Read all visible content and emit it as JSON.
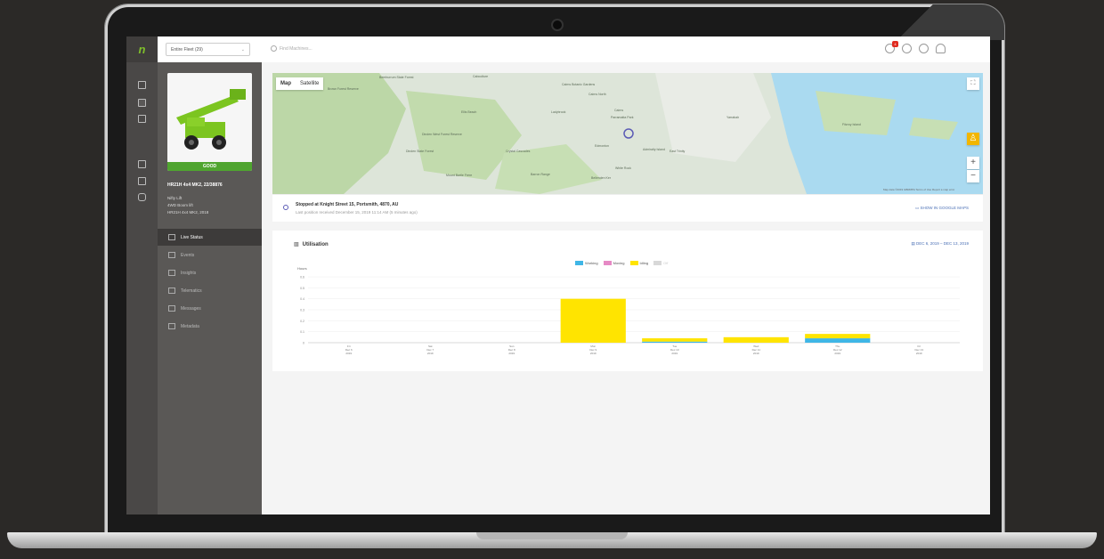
{
  "header": {
    "fleet_select": "Entire Fleet (29)",
    "search_placeholder": "Find Machines...",
    "notification_count": "4"
  },
  "machine": {
    "status": "GOOD",
    "title": "HR21H 4x4 MK2, 22/38876",
    "meta": [
      "Nifty Lift",
      "4WD Boom lift",
      "HR21H 4x4 MK2, 2018"
    ]
  },
  "nav": {
    "items": [
      {
        "label": "Live Status",
        "active": true
      },
      {
        "label": "Events"
      },
      {
        "label": "Insights"
      },
      {
        "label": "Telematics"
      },
      {
        "label": "Messages"
      },
      {
        "label": "Metadata"
      }
    ]
  },
  "map": {
    "tabs": [
      "Map",
      "Satellite"
    ],
    "labels": [
      "Brown Forest Reserve",
      "Beerburrum State Forest",
      "Caboolture",
      "Cairns Botanic Gardens",
      "Cairns North",
      "Ladybrook",
      "Cairns",
      "Parramatta Park",
      "Dinden West Forest Reserve",
      "Dinden State Forest",
      "Crystal Cascades",
      "Edmonton",
      "Barron Range",
      "Fitzroy Island",
      "Mount Bartle Frere",
      "White Rock",
      "Bellenden Ker",
      "Admiralty Island",
      "East Trinity",
      "Ellis Beach",
      "Yarrabah"
    ],
    "footer": "Map data ©2019 GBRMPA   Terms of Use   Report a map error"
  },
  "location": {
    "main": "Stopped at Knight Street 15, Portsmith, 4870, AU",
    "sub": "Last position received December 15, 2019 11:14 AM (5 minutes ago)",
    "link": "SHOW IN GOOGLE MAPS"
  },
  "utilisation": {
    "title": "Utilisation",
    "date_range": "DEC 6, 2019 – DEC 13, 2019"
  },
  "chart_data": {
    "type": "bar",
    "ylabel": "Hours",
    "ylim": [
      0,
      0.6
    ],
    "yticks": [
      "0",
      "0.1",
      "0.2",
      "0.3",
      "0.4",
      "0.5",
      "0.6"
    ],
    "categories": [
      [
        "Fri",
        "Dec 6",
        "2019"
      ],
      [
        "Sat",
        "Dec 7",
        "2019"
      ],
      [
        "Sun",
        "Dec 8",
        "2019"
      ],
      [
        "Mon",
        "Dec 9",
        "2019"
      ],
      [
        "Tue",
        "Dec 10",
        "2019"
      ],
      [
        "Wed",
        "Dec 11",
        "2019"
      ],
      [
        "Thu",
        "Dec 12",
        "2019"
      ],
      [
        "Fri",
        "Dec 13",
        "2019"
      ]
    ],
    "series": [
      {
        "name": "Working",
        "color": "#3fb6e6",
        "values": [
          0,
          0,
          0,
          0,
          0.01,
          0,
          0.04,
          0
        ]
      },
      {
        "name": "Moving",
        "color": "#e68ac5",
        "values": [
          0,
          0,
          0,
          0,
          0,
          0,
          0,
          0
        ]
      },
      {
        "name": "Idling",
        "color": "#ffe400",
        "values": [
          0,
          0,
          0,
          0.4,
          0.03,
          0.05,
          0.04,
          0
        ]
      },
      {
        "name": "Off",
        "color": "#d8d8d8",
        "values": [
          0,
          0,
          0,
          0,
          0,
          0,
          0,
          0
        ]
      }
    ]
  }
}
